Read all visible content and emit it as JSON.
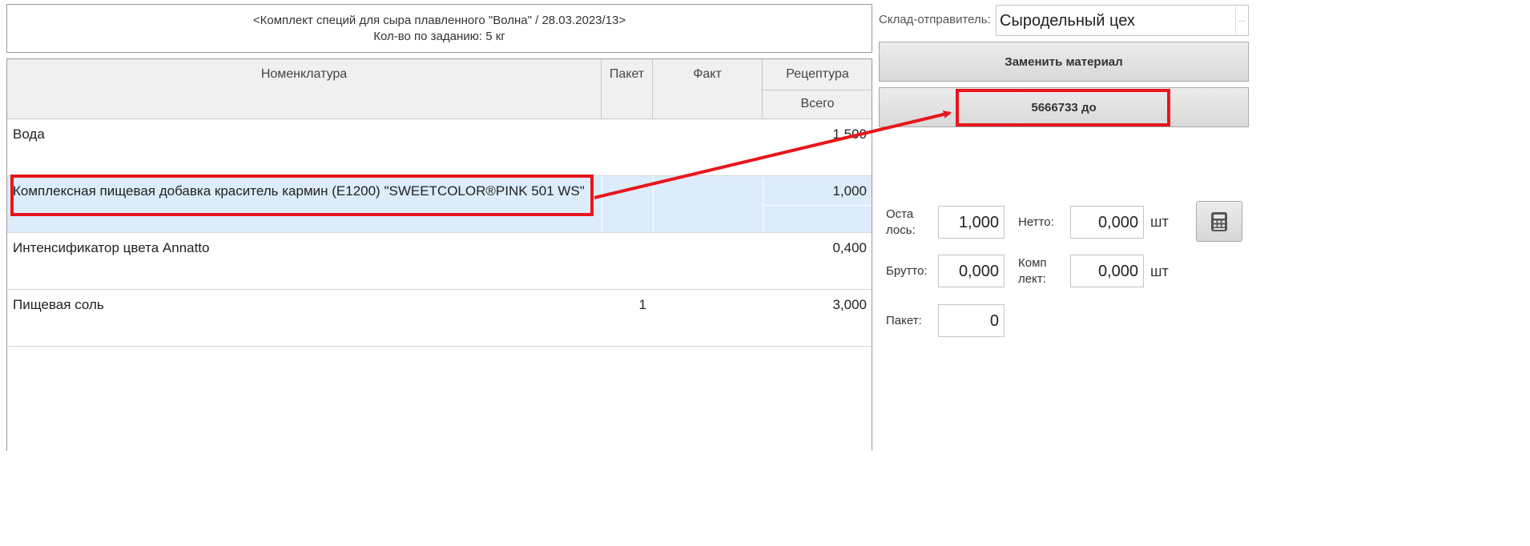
{
  "header": {
    "title": "<Комплект специй для сыра плавленного \"Волна\" / 28.03.2023/13>",
    "quantity": "Кол-во по заданию: 5 кг"
  },
  "grid": {
    "columns": {
      "name": "Номенклатура",
      "packet": "Пакет",
      "fact": "Факт",
      "recipe": "Рецептура",
      "total": "Всего"
    },
    "rows": [
      {
        "name": "Вода",
        "packet": "",
        "fact": "",
        "total": "1,500",
        "selected": false
      },
      {
        "name": "Комплексная пищевая добавка краситель кармин (E1200) \"SWEETCOLOR®PINK 501 WS\"",
        "packet": "",
        "fact": "",
        "total": "1,000",
        "selected": true
      },
      {
        "name": "Интенсификатор цвета Annatto",
        "packet": "",
        "fact": "",
        "total": "0,400",
        "selected": false
      },
      {
        "name": "Пищевая соль",
        "packet": "1",
        "fact": "",
        "total": "3,000",
        "selected": false
      }
    ]
  },
  "warehouse": {
    "label": "Склад-отправитель:",
    "value": "Сыродельный цех",
    "dots": "..."
  },
  "buttons": {
    "replace": "Заменить материал",
    "batch": "5666733 до"
  },
  "fields": {
    "remaining_label_1": "Оста",
    "remaining_label_2": "лось:",
    "remaining_value": "1,000",
    "netto_label": "Нетто:",
    "netto_value": "0,000",
    "netto_unit": "шт",
    "brutto_label": "Брутто:",
    "brutto_value": "0,000",
    "kit_label_1": "Комп",
    "kit_label_2": "лект:",
    "kit_value": "0,000",
    "kit_unit": "шт",
    "packet_label": "Пакет:",
    "packet_value": "0"
  },
  "icons": {
    "calculator": "calculator-icon"
  },
  "colors": {
    "selection": "#dcecfb",
    "annotation": "#e8161c",
    "header_bg": "#f0f0f0"
  }
}
